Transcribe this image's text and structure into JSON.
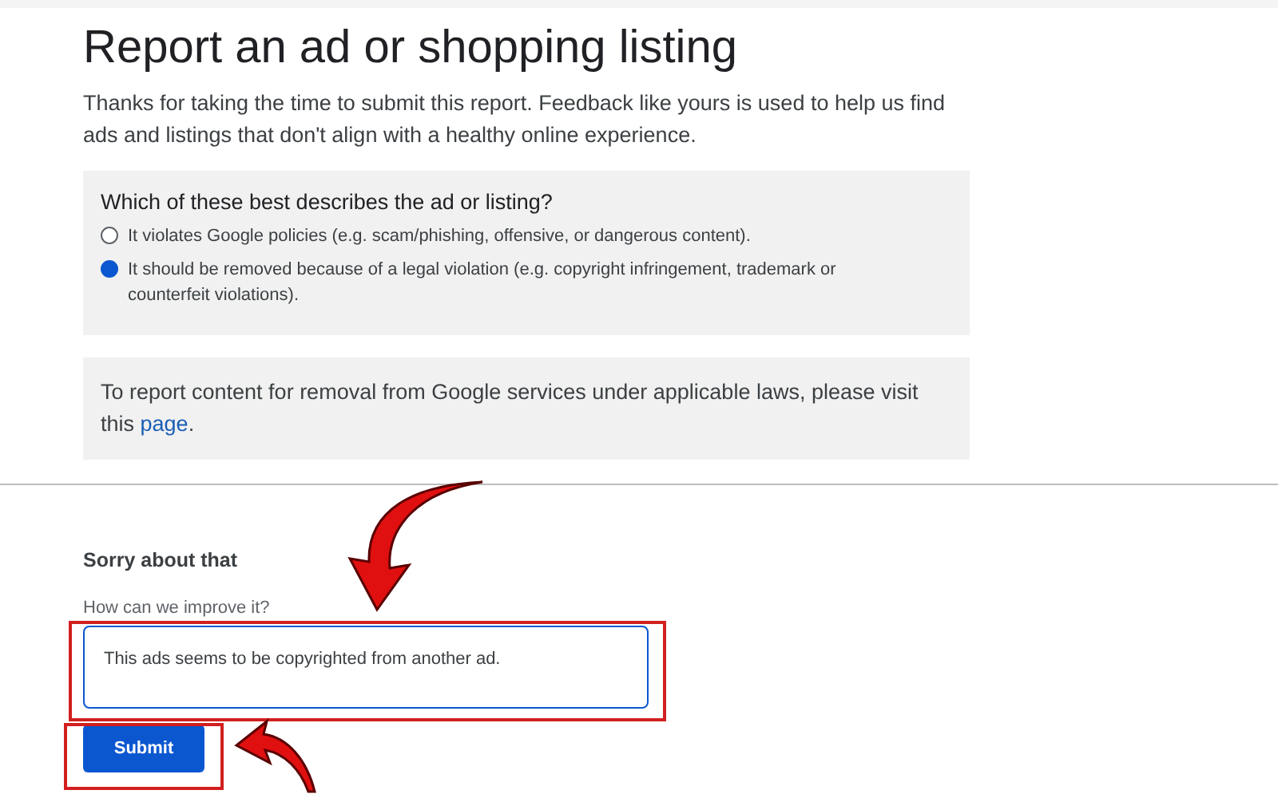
{
  "title": "Report an ad or shopping listing",
  "intro": "Thanks for taking the time to submit this report. Feedback like yours is used to help us find ads and listings that don't align with a healthy online experience.",
  "question": {
    "label": "Which of these best describes the ad or listing?",
    "options": [
      {
        "label": "It violates Google policies (e.g. scam/phishing, offensive, or dangerous content).",
        "selected": false
      },
      {
        "label": "It should be removed because of a legal violation (e.g. copyright infringement, trademark or counterfeit violations).",
        "selected": true
      }
    ]
  },
  "notice": {
    "text": "To report content for removal from Google services under applicable laws, please visit this",
    "link": "page",
    "end": "."
  },
  "feedback": {
    "heading": "Sorry about that",
    "label": "How can we improve it?",
    "value": "This ads seems to be copyrighted from another ad.",
    "button": "Submit"
  }
}
